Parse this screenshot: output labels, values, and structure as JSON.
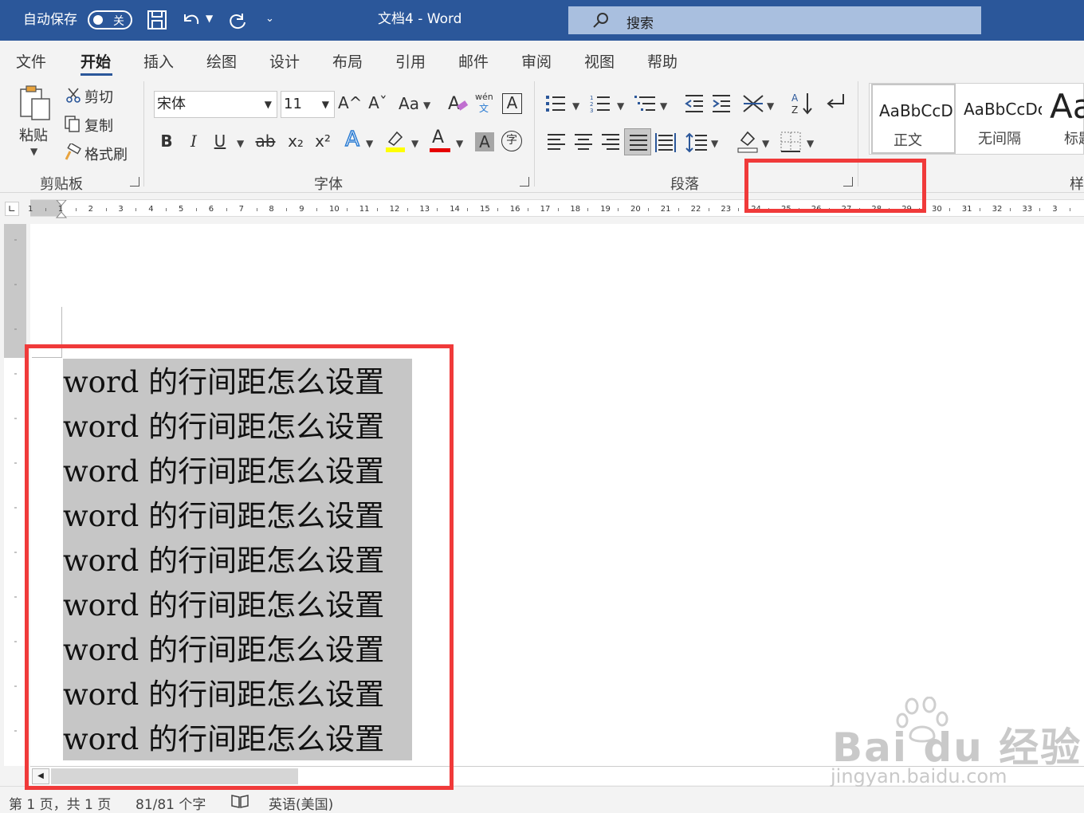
{
  "titlebar": {
    "autosave_label": "自动保存",
    "autosave_state": "关",
    "doc_title": "文档4 - Word",
    "search_placeholder": "搜索"
  },
  "tabs": [
    "文件",
    "开始",
    "插入",
    "绘图",
    "设计",
    "布局",
    "引用",
    "邮件",
    "审阅",
    "视图",
    "帮助"
  ],
  "active_tab": "开始",
  "clipboard": {
    "paste": "粘贴",
    "cut": "剪切",
    "copy": "复制",
    "format_painter": "格式刷",
    "group": "剪贴板"
  },
  "font": {
    "name": "宋体",
    "size": "11",
    "grow": "A^",
    "shrink": "Aˇ",
    "change_case": "Aa",
    "phonetic": "wén",
    "phonetic_sub": "文",
    "char_border": "A",
    "bold": "B",
    "italic": "I",
    "underline": "U",
    "strike": "ab",
    "subscript": "x₂",
    "superscript": "x²",
    "text_effects": "A",
    "font_color": "A",
    "char_shading": "A",
    "enclose": "字",
    "group": "字体",
    "colors": {
      "highlight": "#ffff00",
      "font_color": "#e60000",
      "effects": "#2b7cd3"
    }
  },
  "paragraph": {
    "group": "段落"
  },
  "styles": {
    "items": [
      {
        "preview": "AaBbCcDc",
        "name": "正文"
      },
      {
        "preview": "AaBbCcDc",
        "name": "无间隔"
      },
      {
        "preview": "Aa",
        "name": "标题"
      }
    ],
    "group": "样"
  },
  "ruler": {
    "ticks": [
      "1",
      "1",
      "2",
      "3",
      "4",
      "5",
      "6",
      "7",
      "8",
      "9",
      "10",
      "11",
      "12",
      "13",
      "14",
      "15",
      "16",
      "17",
      "18",
      "19",
      "20",
      "21",
      "22",
      "23",
      "24",
      "25",
      "26",
      "27",
      "28",
      "29",
      "30",
      "31",
      "32",
      "33",
      "3"
    ]
  },
  "document": {
    "lines": [
      "word 的行间距怎么设置",
      "word 的行间距怎么设置",
      "word 的行间距怎么设置",
      "word 的行间距怎么设置",
      "word 的行间距怎么设置",
      "word 的行间距怎么设置",
      "word 的行间距怎么设置",
      "word 的行间距怎么设置",
      "word 的行间距怎么设置"
    ]
  },
  "status": {
    "page": "第 1 页，共 1 页",
    "words": "81/81 个字",
    "language": "英语(美国)"
  },
  "watermark": {
    "brand": "Bai du 经验",
    "url": "jingyan.baidu.com"
  },
  "colors": {
    "title_bar": "#2b579a",
    "highlight_box": "#f03a3a",
    "selection": "#c6c6c6"
  }
}
